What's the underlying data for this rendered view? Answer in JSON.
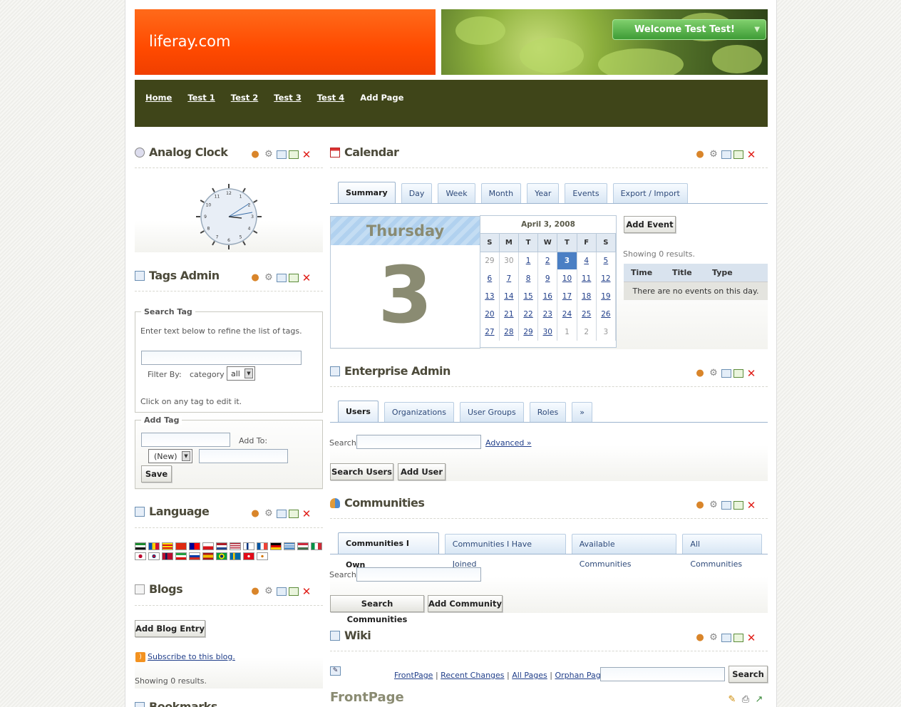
{
  "header": {
    "logo": "liferay.com",
    "welcome": "Welcome Test Test!",
    "welcome_arrow": "▼"
  },
  "nav": {
    "items": [
      "Home",
      "Test 1",
      "Test 2",
      "Test 3",
      "Test 4",
      "Add Page"
    ]
  },
  "analog_clock": {
    "title": "Analog Clock",
    "numbers": [
      "12",
      "1",
      "2",
      "3",
      "4",
      "5",
      "6",
      "7",
      "8",
      "9",
      "10",
      "11"
    ]
  },
  "tags_admin": {
    "title": "Tags Admin",
    "search_legend": "Search Tag",
    "instructions": "Enter text below to refine the list of tags.",
    "filter_by": "Filter By:",
    "category": "category",
    "filter_value": "all",
    "click_hint": "Click on any tag to edit it.",
    "add_legend": "Add Tag",
    "add_to": "Add To:",
    "new_value": "(New)",
    "save": "Save"
  },
  "language": {
    "title": "Language"
  },
  "blogs": {
    "title": "Blogs",
    "add_entry": "Add Blog Entry",
    "subscribe": "Subscribe to this blog.",
    "showing": "Showing 0 results."
  },
  "bookmarks": {
    "title": "Bookmarks"
  },
  "calendar": {
    "title": "Calendar",
    "tabs": [
      "Summary",
      "Day",
      "Week",
      "Month",
      "Year",
      "Events",
      "Export / Import"
    ],
    "day_name": "Thursday",
    "day_number": "3",
    "month_label": "April 3, 2008",
    "weekdays": [
      "S",
      "M",
      "T",
      "W",
      "T",
      "F",
      "S"
    ],
    "weeks": [
      [
        "29",
        "30",
        "1",
        "2",
        "3",
        "4",
        "5"
      ],
      [
        "6",
        "7",
        "8",
        "9",
        "10",
        "11",
        "12"
      ],
      [
        "13",
        "14",
        "15",
        "16",
        "17",
        "18",
        "19"
      ],
      [
        "20",
        "21",
        "22",
        "23",
        "24",
        "25",
        "26"
      ],
      [
        "27",
        "28",
        "29",
        "30",
        "1",
        "2",
        "3"
      ]
    ],
    "add_event": "Add Event",
    "showing": "Showing 0 results.",
    "columns": [
      "Time",
      "Title",
      "Type"
    ],
    "no_events": "There are no events on this day."
  },
  "enterprise_admin": {
    "title": "Enterprise Admin",
    "tabs": [
      "Users",
      "Organizations",
      "User Groups",
      "Roles",
      "»"
    ],
    "search_label": "Search",
    "advanced": "Advanced »",
    "search_users": "Search Users",
    "add_user": "Add User"
  },
  "communities": {
    "title": "Communities",
    "tabs": [
      "Communities I Own",
      "Communities I Have Joined",
      "Available Communities",
      "All Communities"
    ],
    "search_label": "Search",
    "search_btn": "Search Communities",
    "add_btn": "Add Community"
  },
  "wiki": {
    "title": "Wiki",
    "links": [
      "FrontPage",
      "Recent Changes",
      "All Pages",
      "Orphan Pages"
    ],
    "search_btn": "Search",
    "page_title": "FrontPage"
  },
  "colors": {
    "orange": "#ff4a00",
    "nav": "#3f4519",
    "link": "#213f8a"
  }
}
